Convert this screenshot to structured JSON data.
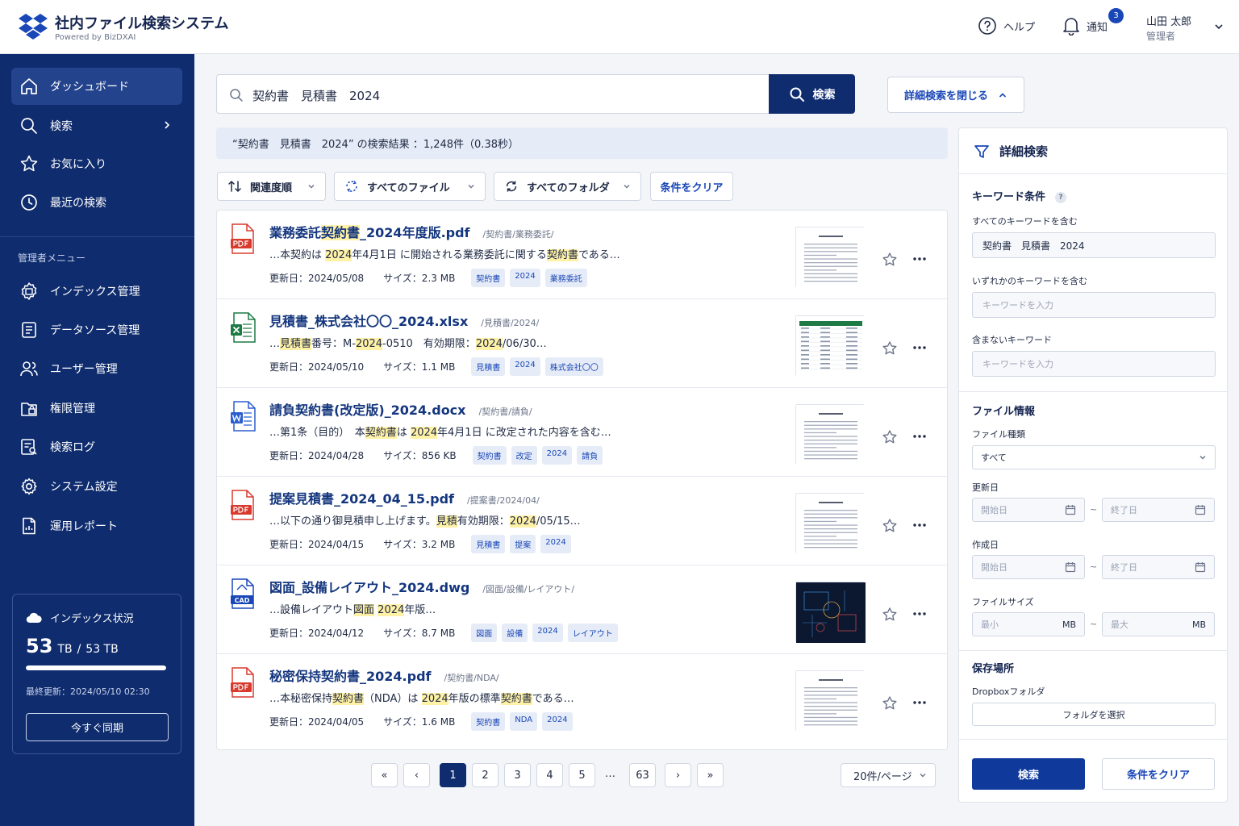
{
  "header": {
    "title": "社内ファイル検索システム",
    "subtitle": "Powered by BizDXAI",
    "help_label": "ヘルプ",
    "notify_label": "通知",
    "notify_count": "3",
    "user_name": "山田 太郎",
    "user_role": "管理者"
  },
  "sidebar": {
    "nav": [
      {
        "label": "ダッシュボード",
        "icon": "home-icon"
      },
      {
        "label": "検索",
        "icon": "search-icon"
      },
      {
        "label": "お気に入り",
        "icon": "star-icon"
      },
      {
        "label": "最近の検索",
        "icon": "clock-icon"
      }
    ],
    "admin_section": "管理者メニュー",
    "admin": [
      {
        "label": "インデックス管理",
        "icon": "index-gear-icon"
      },
      {
        "label": "データソース管理",
        "icon": "database-icon"
      },
      {
        "label": "ユーザー管理",
        "icon": "users-icon"
      },
      {
        "label": "権限管理",
        "icon": "lock-folder-icon"
      },
      {
        "label": "検索ログ",
        "icon": "search-log-icon"
      },
      {
        "label": "システム設定",
        "icon": "gear-icon"
      },
      {
        "label": "運用レポート",
        "icon": "report-icon"
      }
    ],
    "index_status": {
      "title": "インデックス状況",
      "used": "53",
      "used_unit": "TB",
      "separator": "/",
      "total": "53 TB",
      "progress": 1.0,
      "updated": "最終更新：2024/05/10 02:30",
      "sync_label": "今すぐ同期"
    }
  },
  "search": {
    "query": "契約書　見積書　2024",
    "button": "検索",
    "adv_toggle": "詳細検索を閉じる",
    "summary": "“契約書　見積書　2024” の検索結果 ：1,248件（0.38秒）"
  },
  "filters": {
    "sort": "関連度順",
    "file_type": "すべてのファイル",
    "folder": "すべてのフォルダ",
    "clear": "条件をクリア"
  },
  "results": [
    {
      "type": "pdf",
      "name_parts": [
        "業務委託",
        "契約書",
        "_2024年度版.pdf"
      ],
      "path": "/契約書/業務委託/",
      "snippet": [
        [
          "…本契約は ",
          false
        ],
        [
          "2024",
          true
        ],
        [
          "年4月1日 に開始される業務委託に関する",
          false
        ],
        [
          "契約書",
          true
        ],
        [
          "である…",
          false
        ]
      ],
      "updated": "更新日：2024/05/08",
      "size": "サイズ：2.3 MB",
      "tags": [
        "契約書",
        "2024",
        "業務委託"
      ]
    },
    {
      "type": "xlsx",
      "name_parts": [
        "見積書_株式会社〇〇_2024.xlsx",
        "",
        ""
      ],
      "path": "/見積書/2024/",
      "snippet": [
        [
          "…",
          false
        ],
        [
          "見積書",
          true
        ],
        [
          "番号：M-",
          false
        ],
        [
          "2024",
          true
        ],
        [
          "-0510　有効期限：",
          false
        ],
        [
          "2024",
          true
        ],
        [
          "/06/30…",
          false
        ]
      ],
      "updated": "更新日：2024/05/10",
      "size": "サイズ：1.1 MB",
      "tags": [
        "見積書",
        "2024",
        "株式会社〇〇"
      ]
    },
    {
      "type": "docx",
      "name_parts": [
        "請負契約書(改定版)_2024.docx",
        "",
        ""
      ],
      "path": "/契約書/請負/",
      "snippet": [
        [
          "…第1条（目的）　本",
          false
        ],
        [
          "契約書",
          true
        ],
        [
          "は ",
          false
        ],
        [
          "2024",
          true
        ],
        [
          "年4月1日 に改定された内容を含む…",
          false
        ]
      ],
      "updated": "更新日：2024/04/28",
      "size": "サイズ：856 KB",
      "tags": [
        "契約書",
        "改定",
        "2024",
        "請負"
      ]
    },
    {
      "type": "pdf",
      "name_parts": [
        "提案見積書_2024_04_15.pdf",
        "",
        ""
      ],
      "path": "/提案書/2024/04/",
      "snippet": [
        [
          "…以下の通り御見積申し上げます。",
          false
        ],
        [
          "見積",
          true
        ],
        [
          "有効期限：",
          false
        ],
        [
          "2024",
          true
        ],
        [
          "/05/15…",
          false
        ]
      ],
      "updated": "更新日：2024/04/15",
      "size": "サイズ：3.2 MB",
      "tags": [
        "見積書",
        "提案",
        "2024"
      ]
    },
    {
      "type": "cad",
      "name_parts": [
        "図面_設備レイアウト_2024.dwg",
        "",
        ""
      ],
      "path": "/図面/設備/レイアウト/",
      "snippet": [
        [
          "…設備レイアウト",
          false
        ],
        [
          "図面",
          true
        ],
        [
          " ",
          false
        ],
        [
          "2024",
          true
        ],
        [
          "年版…",
          false
        ]
      ],
      "updated": "更新日：2024/04/12",
      "size": "サイズ：8.7 MB",
      "tags": [
        "図面",
        "設備",
        "2024",
        "レイアウト"
      ]
    },
    {
      "type": "pdf",
      "name_parts": [
        "秘密保持契約書_2024.pdf",
        "",
        ""
      ],
      "path": "/契約書/NDA/",
      "snippet": [
        [
          "…本秘密保持",
          false
        ],
        [
          "契約書",
          true
        ],
        [
          "（NDA）は ",
          false
        ],
        [
          "2024",
          true
        ],
        [
          "年版の標準",
          false
        ],
        [
          "契約書",
          true
        ],
        [
          "である…",
          false
        ]
      ],
      "updated": "更新日：2024/04/05",
      "size": "サイズ：1.6 MB",
      "tags": [
        "契約書",
        "NDA",
        "2024"
      ]
    }
  ],
  "pagination": {
    "first": "«",
    "prev": "‹",
    "pages": [
      "1",
      "2",
      "3",
      "4",
      "5"
    ],
    "dots": "…",
    "last_page": "63",
    "next": "›",
    "last": "»",
    "active": "1",
    "per_page": "20件/ページ"
  },
  "panel": {
    "title": "詳細検索",
    "keyword_section": "キーワード条件",
    "help": "?",
    "all_label": "すべてのキーワードを含む",
    "all_value": "契約書　見積書　2024",
    "any_label": "いずれかのキーワードを含む",
    "any_placeholder": "キーワードを入力",
    "none_label": "含まないキーワード",
    "none_placeholder": "キーワードを入力",
    "file_section": "ファイル情報",
    "type_label": "ファイル種類",
    "type_value": "すべて",
    "updated_label": "更新日",
    "created_label": "作成日",
    "start_placeholder": "開始日",
    "end_placeholder": "終了日",
    "tilde": "~",
    "size_label": "ファイルサイズ",
    "min_placeholder": "最小",
    "max_placeholder": "最大",
    "size_unit": "MB",
    "location_section": "保存場所",
    "location_label": "Dropboxフォルダ",
    "folder_button": "フォルダを選択",
    "search_button": "検索",
    "clear_button": "条件をクリア"
  },
  "colors": {
    "sidebar": "#0f2c6e",
    "accent": "#1a47b8",
    "highlight": "#fff1a6",
    "pdf": "#d83a2e",
    "xlsx": "#1d7a45",
    "docx": "#2b5fcf",
    "cad": "#1a47b8"
  }
}
